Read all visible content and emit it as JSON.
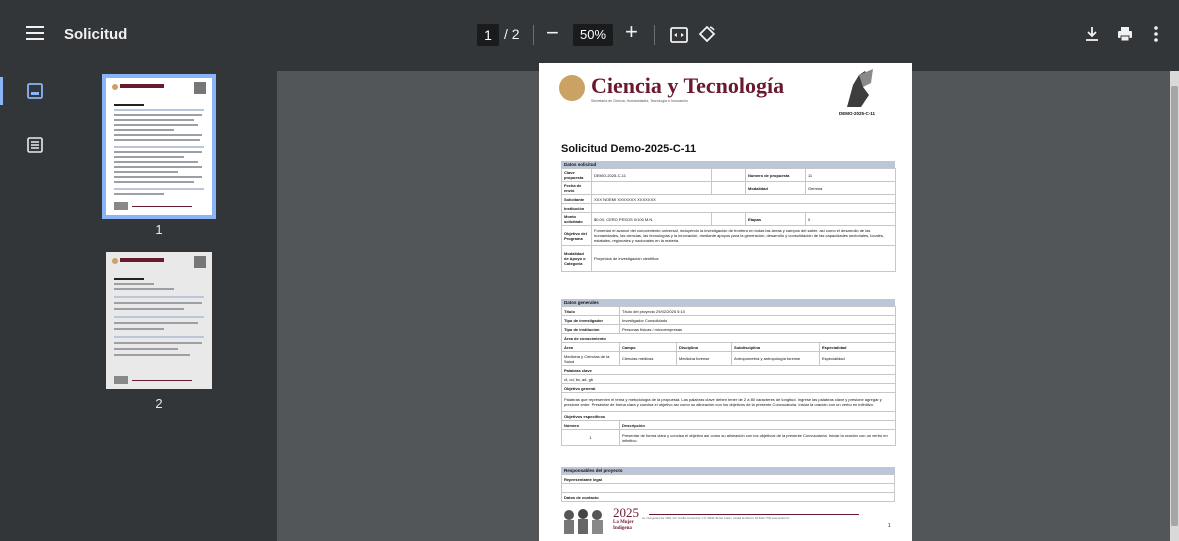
{
  "toolbar": {
    "title": "Solicitud",
    "page_current": "1",
    "page_total": "/ 2",
    "zoom_minus": "−",
    "zoom": "50%",
    "zoom_plus": "+"
  },
  "sidebar": {
    "thumbnails": [
      {
        "number": "1",
        "selected": true
      },
      {
        "number": "2",
        "selected": false
      }
    ]
  },
  "document": {
    "brand_title": "Ciencia y Tecnología",
    "brand_subtitle": "Secretaría de Ciencia, Humanidades, Tecnología e Innovación",
    "folio": "DEMO-2025-C-11",
    "title": "Solicitud Demo-2025-C-11",
    "sec1": "Datos solicitud",
    "clave_label": "Clave propuesta",
    "clave_val": "DEMO-2025-C-11",
    "numprop_label": "Número de propuesta",
    "numprop_val": "11",
    "fecha_label": "Fecha de envío",
    "modalidad_label": "Modalidad",
    "modalidad_val": "Gemma",
    "solicitante_label": "Solicitante",
    "solicitante_val": "XXX NOEMI XXXXXXX XXXXXXX",
    "institucion_label": "Institución",
    "monto_label": "Monto solicitado",
    "monto_val": "$0.00, CERO PESOS 0/100 M.N.",
    "etapas_label": "Etapas",
    "etapas_val": "0",
    "objetivo_label": "Objetivo del Programa",
    "objetivo_val": "Fomentar el avance del conocimiento universal, incluyendo la investigación de frontera en todas las áreas y campos del saber, así como el desarrollo de las humanidades, las ciencias, las tecnologías y la innovación, mediante apoyos para la generación, desarrollo y consolidación de las capacidades sectoriales, locales, estatales, regionales y nacionales en la materia.",
    "modapoyo_label": "Modalidad de Apoyo o Categoría",
    "modapoyo_val": "Proyectos de investigación científica",
    "sec2": "Datos generales",
    "titulo_label": "Título",
    "titulo_val": "Título del proyecto 29/02/2025 5:10",
    "tipoinv_label": "Tipo de investigador",
    "tipoinv_val": "Investigador Consolidado",
    "tipoinst_label": "Tipo de institucion",
    "tipoinst_val": "Personas físicas / microempresas",
    "area_conoc_label": "Área de conocimiento",
    "col_area": "Área",
    "col_campo": "Campo",
    "col_disciplina": "Disciplina",
    "col_subdisciplina": "Subdisciplina",
    "col_especialidad": "Especialidad",
    "row_area": "Medicina y Ciencias de la Salud",
    "row_campo": "Ciencias médicas",
    "row_disciplina": "Medicina forense",
    "row_subdisciplina": "Antropometría y antropología forense",
    "row_especialidad": "Especialidad",
    "palabras_label": "Palabras clave",
    "palabras_val": "vf, cd, bv, ad, gb",
    "objgen_label": "Objetivo general",
    "objgen_val": "Palabras que representen el tema y metodología de la propuesta. Las palabras clave deben tener de 2 a 80 caracteres de longitud. Ingrese las palabras clave y presione agregar y presione enter. Presentar de forma clara y concisa el objetivo así como su alineación con los objetivos de la presente Convocatoria. Iniciar la oración con un verbo en infinitivo.",
    "objesp_label": "Objetivos específicos",
    "col_numero": "Número",
    "col_descripcion": "Descripción",
    "objesp_num": "1",
    "objesp_desc": "Presentar de forma clara y concisa el objetivo así como su alineación con los objetivos de la presente Convocatoria. Iniciar la oración con un verbo en infinitivo.",
    "sec3": "Responsables del proyecto",
    "replegal_label": "Representante legal",
    "contacto_label": "Datos de contacto",
    "footer_year": "2025",
    "footer_mujer": "La Mujer Indígena",
    "footer_addr": "Av. Insurgentes Sur 1582, Col. Crédito Constructor, C.P. 03940, Benito Juárez, Ciudad de México. 55 5322 7700   www.secihti.mx",
    "page_number": "1"
  },
  "colors": {
    "toolbar": "#323639",
    "viewer_bg": "#525659",
    "accent": "#8ab4f8",
    "brand": "#6a1a2e"
  }
}
